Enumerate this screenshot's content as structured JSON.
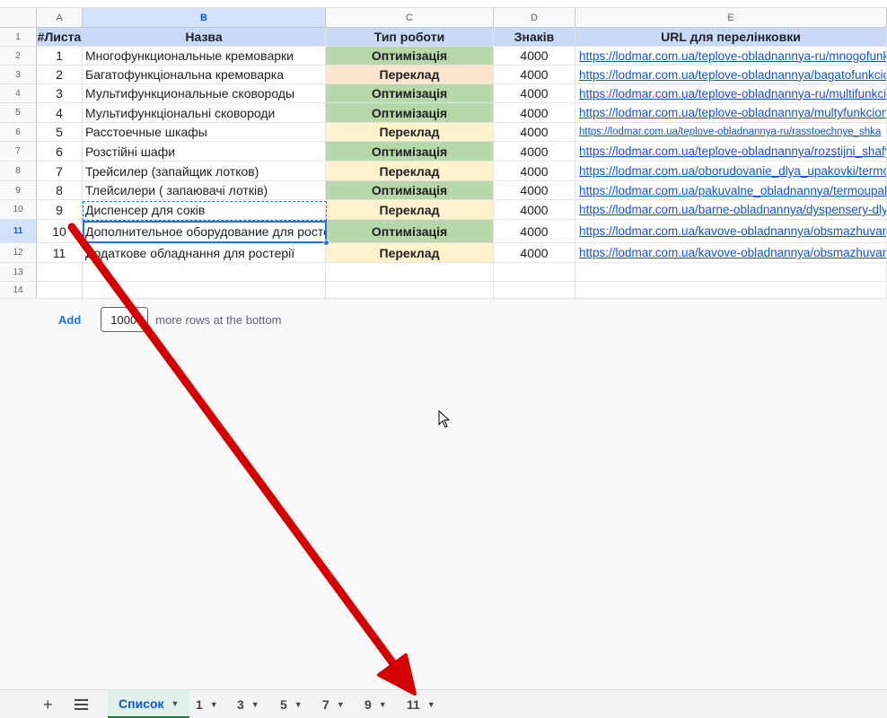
{
  "columns": [
    "A",
    "B",
    "C",
    "D",
    "E"
  ],
  "headers": {
    "num": "#Листа",
    "name": "Назва",
    "type": "Тип роботи",
    "chars": "Знаків",
    "url": "URL для перелінковки"
  },
  "row_numbers": [
    "1",
    "2",
    "3",
    "4",
    "5",
    "6",
    "7",
    "8",
    "9",
    "10",
    "11",
    "12",
    "13",
    "14"
  ],
  "rows": [
    {
      "num": "1",
      "name": "Многофункциональные кремоварки",
      "type": "Оптимізація",
      "chars": "4000",
      "url": "https://lodmar.com.ua/teplove-obladnannya-ru/mnogofunkci"
    },
    {
      "num": "2",
      "name": "Багатофункціональна кремоварка",
      "type": "Переклад",
      "chars": "4000",
      "url": "https://lodmar.com.ua/teplove-obladnannya/bagatofunkcion"
    },
    {
      "num": "3",
      "name": "Мультифункциональные сковороды",
      "type": "Оптимізація",
      "chars": "4000",
      "url": "https://lodmar.com.ua/teplove-obladnannya-ru/multifunkcio"
    },
    {
      "num": "4",
      "name": "Мультифункціональні сковороди",
      "type": "Оптимізація",
      "chars": "4000",
      "url": "https://lodmar.com.ua/teplove-obladnannya/multyfunkciona"
    },
    {
      "num": "5",
      "name": "Расстоечные шкафы",
      "type": "Переклад",
      "chars": "4000",
      "url": "https://lodmar.com.ua/teplove-obladnannya-ru/rasstoechnye_shka"
    },
    {
      "num": "6",
      "name": "Розстійні шафи",
      "type": "Оптимізація",
      "chars": "4000",
      "url": "https://lodmar.com.ua/teplove-obladnannya/rozstijni_shafy/"
    },
    {
      "num": "7",
      "name": "Трейсилер (запайщик лотков)",
      "type": "Переклад",
      "chars": "4000",
      "url": "https://lodmar.com.ua/oborudovanie_dlya_upakovki/termou"
    },
    {
      "num": "8",
      "name": "Тлейсилери ( запаювачі лотків)",
      "type": "Оптимізація",
      "chars": "4000",
      "url": "https://lodmar.com.ua/pakuvalne_obladnannya/termoupako"
    },
    {
      "num": "9",
      "name": "Диспенсер для соків",
      "type": "Переклад",
      "chars": "4000",
      "url": "https://lodmar.com.ua/barne-obladnannya/dyspensery-dlya"
    },
    {
      "num": "10",
      "name": "Дополнительное оборудование для ростери",
      "type": "Оптимізація",
      "chars": "4000",
      "url": "https://lodmar.com.ua/kavove-obladnannya/obsmazhuvann"
    },
    {
      "num": "11",
      "name": "Додаткове обладнання для ростерії",
      "type": "Переклад",
      "chars": "4000",
      "url": "https://lodmar.com.ua/kavove-obladnannya/obsmazhuvann"
    }
  ],
  "add_rows": {
    "button": "Add",
    "count": "1000",
    "suffix": "more rows at the bottom"
  },
  "sheets": {
    "active": "Список",
    "others": [
      "1",
      "3",
      "5",
      "7",
      "9",
      "11"
    ]
  },
  "colors": {
    "header_fill": "#c9daf8",
    "optimization_fill": "#b6d7a8",
    "translation_fill": "#fff2cc",
    "link": "#1155cc",
    "arrow": "#d40000"
  }
}
